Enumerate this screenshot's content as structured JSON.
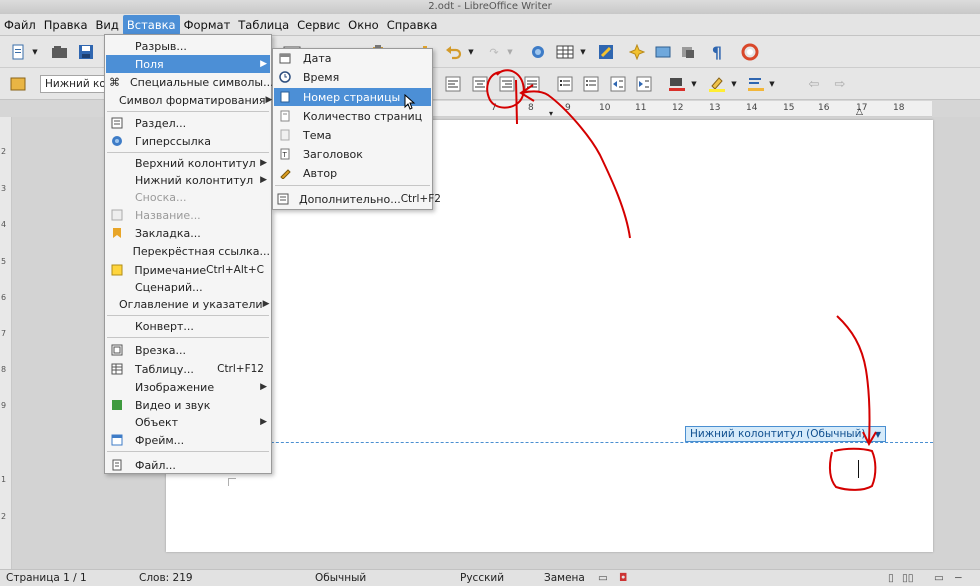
{
  "window": {
    "title": "2.odt - LibreOffice Writer"
  },
  "menubar": {
    "items": [
      {
        "label": "Файл"
      },
      {
        "label": "Правка"
      },
      {
        "label": "Вид"
      },
      {
        "label": "Вставка"
      },
      {
        "label": "Формат"
      },
      {
        "label": "Таблица"
      },
      {
        "label": "Сервис"
      },
      {
        "label": "Окно"
      },
      {
        "label": "Справка"
      }
    ]
  },
  "toolbar": {
    "paragraph_style": "Нижний колонтитул"
  },
  "ruler": {
    "labels": [
      "7",
      "8",
      "9",
      "10",
      "11",
      "12",
      "13",
      "14",
      "15",
      "16",
      "17",
      "18"
    ]
  },
  "vruler": {
    "labels": [
      "2",
      "3",
      "4",
      "5",
      "6",
      "7",
      "8",
      "9",
      "1",
      "2"
    ]
  },
  "insert_menu": {
    "items": [
      {
        "label": "Разрыв...",
        "icon": ""
      },
      {
        "label": "Поля",
        "icon": "",
        "submenu": true,
        "highlighted": true
      },
      {
        "label": "Специальные символы...",
        "icon": "⌘"
      },
      {
        "label": "Символ форматирования",
        "icon": "",
        "submenu": true
      },
      {
        "label": "Раздел...",
        "icon": "section-icon"
      },
      {
        "label": "Гиперссылка",
        "icon": "hyperlink-icon"
      },
      {
        "label": "Верхний колонтитул",
        "icon": "",
        "submenu": true
      },
      {
        "label": "Нижний колонтитул",
        "icon": "",
        "submenu": true
      },
      {
        "label": "Сноска...",
        "icon": "",
        "disabled": true
      },
      {
        "label": "Название...",
        "icon": "caption-icon",
        "disabled": true
      },
      {
        "label": "Закладка...",
        "icon": "bookmark-icon"
      },
      {
        "label": "Перекрёстная ссылка...",
        "icon": ""
      },
      {
        "label": "Примечание",
        "icon": "comment-icon",
        "shortcut": "Ctrl+Alt+C"
      },
      {
        "label": "Сценарий...",
        "icon": ""
      },
      {
        "label": "Оглавление и указатели",
        "icon": "",
        "submenu": true
      },
      {
        "label": "Конверт...",
        "icon": ""
      },
      {
        "label": "Врезка...",
        "icon": "frame-icon"
      },
      {
        "label": "Таблицу...",
        "icon": "table-icon",
        "shortcut": "Ctrl+F12"
      },
      {
        "label": "Изображение",
        "icon": "",
        "submenu": true
      },
      {
        "label": "Видео и звук",
        "icon": "media-icon"
      },
      {
        "label": "Объект",
        "icon": "",
        "submenu": true
      },
      {
        "label": "Фрейм...",
        "icon": "floating-frame-icon"
      },
      {
        "label": "Файл...",
        "icon": "file-icon"
      }
    ]
  },
  "fields_submenu": {
    "items": [
      {
        "label": "Дата",
        "icon": "date-icon"
      },
      {
        "label": "Время",
        "icon": "time-icon"
      },
      {
        "label": "Номер страницы",
        "icon": "page-number-icon",
        "highlighted": true
      },
      {
        "label": "Количество страниц",
        "icon": "page-count-icon"
      },
      {
        "label": "Тема",
        "icon": "subject-icon"
      },
      {
        "label": "Заголовок",
        "icon": "title-icon"
      },
      {
        "label": "Автор",
        "icon": "author-icon"
      },
      {
        "label": "Дополнительно...",
        "icon": "more-fields-icon",
        "shortcut": "Ctrl+F2"
      }
    ]
  },
  "document": {
    "footer_label": "Нижний колонтитул (Обычный)"
  },
  "statusbar": {
    "page": "Страница 1 / 1",
    "words": "Слов: 219",
    "page_style": "Обычный",
    "language": "Русский",
    "insert_mode": "Замена"
  },
  "colors": {
    "accent": "#4c8fd6",
    "annotation": "#d40000",
    "footer_border": "#4a8fd1"
  }
}
